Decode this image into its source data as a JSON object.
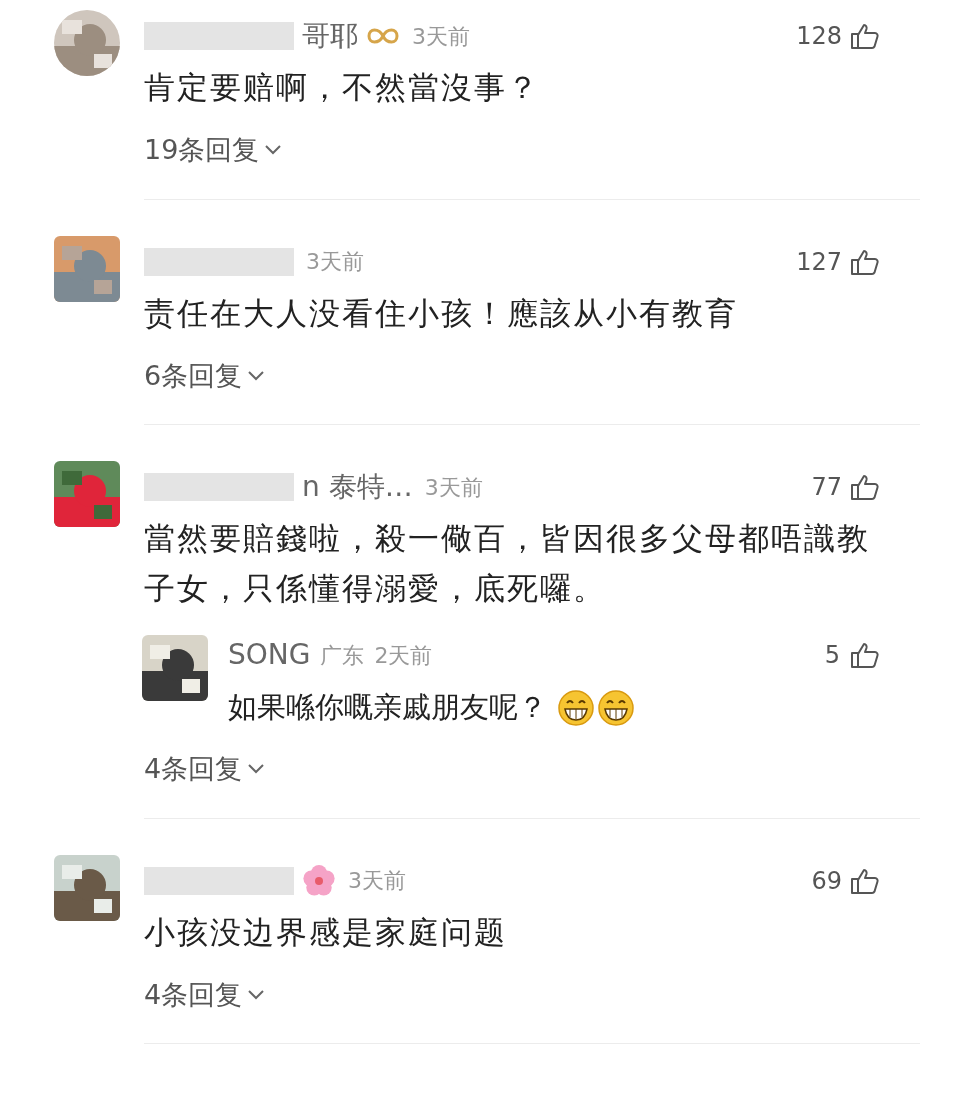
{
  "comments": [
    {
      "avatar": {
        "kind": "circle"
      },
      "name_hidden": true,
      "name": "哥耶",
      "badge": {
        "kind": "infinity"
      },
      "time": "3天前",
      "likes": "128",
      "text": "肯定要赔啊，不然當沒事？",
      "replies_label": "19条回复"
    },
    {
      "avatar": {
        "kind": "square"
      },
      "name_hidden": true,
      "time": "3天前",
      "likes": "127",
      "text": "责任在大人没看住小孩！應該从小有教育",
      "replies_label": "6条回复"
    },
    {
      "avatar": {
        "kind": "square"
      },
      "name_hidden": true,
      "name": "n 泰特…",
      "time": "3天前",
      "likes": "77",
      "text": "當然要賠錢啦，殺一儆百，皆因很多父母都唔識教子女，只係懂得溺愛，底死囉。",
      "replies": [
        {
          "name": "SONG",
          "location": "广东",
          "time": "2天前",
          "likes": "5",
          "text": "如果喺你嘅亲戚朋友呢？",
          "emojis": [
            {
              "kind": "grin"
            },
            {
              "kind": "grin"
            }
          ]
        }
      ],
      "replies_label": "4条回复"
    },
    {
      "avatar": {
        "kind": "square"
      },
      "name_hidden": true,
      "badge": {
        "kind": "flower"
      },
      "time": "3天前",
      "likes": "69",
      "text": "小孩没边界感是家庭问题",
      "replies_label": "4条回复"
    }
  ]
}
